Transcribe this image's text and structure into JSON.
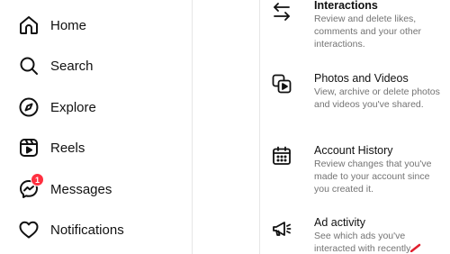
{
  "sidebar": {
    "items": [
      {
        "icon": "home-icon",
        "label": "Home"
      },
      {
        "icon": "search-icon",
        "label": "Search"
      },
      {
        "icon": "compass-icon",
        "label": "Explore"
      },
      {
        "icon": "reels-icon",
        "label": "Reels"
      },
      {
        "icon": "messenger-icon",
        "label": "Messages",
        "badge": "1"
      },
      {
        "icon": "heart-icon",
        "label": "Notifications"
      }
    ]
  },
  "activity": {
    "items": [
      {
        "icon": "arrows-exchange-icon",
        "title": "Interactions",
        "description": "Review and delete likes, comments and your other interactions."
      },
      {
        "icon": "photos-videos-icon",
        "title": "Photos and Videos",
        "description": "View, archive or delete photos and videos you've shared."
      },
      {
        "icon": "calendar-icon",
        "title": "Account History",
        "description": "Review changes that you've made to your account since you created it."
      },
      {
        "icon": "megaphone-icon",
        "title": "Ad activity",
        "description": "See which ads you've interacted with recently."
      }
    ]
  },
  "colors": {
    "badge": "#ff3040",
    "description_text": "#737373",
    "divider": "#e6e6e6",
    "annotation": "#e0202e"
  }
}
